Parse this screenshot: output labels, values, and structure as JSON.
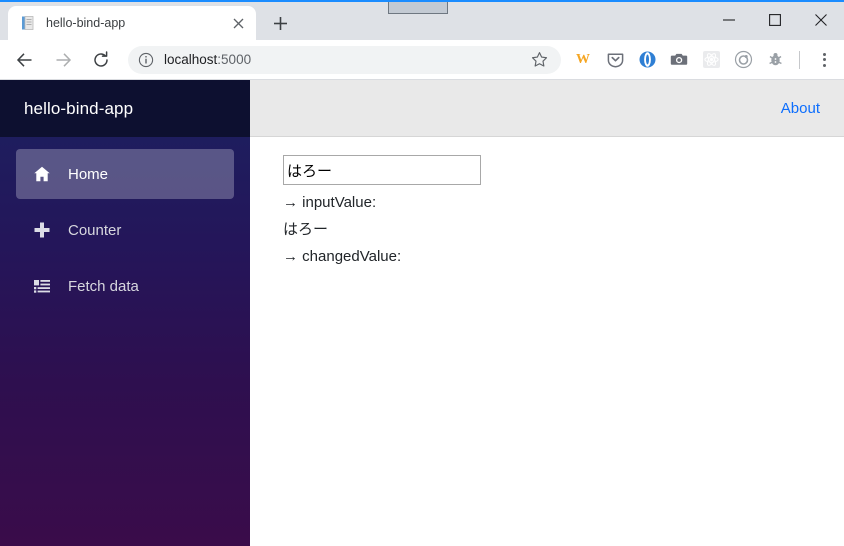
{
  "browser": {
    "tab": {
      "title": "hello-bind-app",
      "favicon_icon": "document-icon",
      "close_icon": "close-icon"
    },
    "new_tab_label": "+",
    "new_tab_icon": "plus-icon",
    "window_controls": {
      "minimize_icon": "minimize-icon",
      "maximize_icon": "maximize-icon",
      "close_icon": "close-icon"
    },
    "toolbar": {
      "back_icon": "back-arrow-icon",
      "forward_icon": "forward-arrow-icon",
      "reload_icon": "reload-icon",
      "site_info_icon": "info-circle-icon",
      "url": "localhost:5000",
      "url_host": "localhost",
      "url_port": ":5000",
      "bookmark_icon": "star-icon",
      "menu_icon": "three-dots-vertical-icon",
      "extensions": [
        {
          "name": "W",
          "icon": "w-letter-icon",
          "label": "W"
        },
        {
          "name": "pocket",
          "icon": "pocket-shield-icon",
          "label": ""
        },
        {
          "name": "blue-circle",
          "icon": "blue-circle-icon",
          "label": ""
        },
        {
          "name": "camera",
          "icon": "camera-icon",
          "label": ""
        },
        {
          "name": "react-devtools",
          "icon": "react-atom-icon",
          "label": ""
        },
        {
          "name": "target",
          "icon": "target-circle-icon",
          "label": ""
        },
        {
          "name": "bug",
          "icon": "bug-icon",
          "label": ""
        }
      ]
    }
  },
  "app": {
    "brand": "hello-bind-app",
    "sidebar": {
      "items": [
        {
          "label": "Home",
          "icon": "home-icon",
          "active": true
        },
        {
          "label": "Counter",
          "icon": "plus-icon",
          "active": false
        },
        {
          "label": "Fetch data",
          "icon": "list-icon",
          "active": false
        }
      ]
    },
    "topbar": {
      "about_label": "About"
    },
    "content": {
      "input_value": "はろー",
      "input_placeholder": "",
      "lines": [
        "→ inputValue:",
        "はろー",
        "→ changedValue:"
      ]
    }
  },
  "colors": {
    "accent_blue": "#1a8cff",
    "link_blue": "#0d6efd",
    "brand_bar": "#0d1030",
    "sidebar_top": "#1b2160",
    "sidebar_bottom": "#3a0c4a",
    "topbar_gray": "#e9e9e9",
    "extension_w_orange": "#f5a623"
  }
}
